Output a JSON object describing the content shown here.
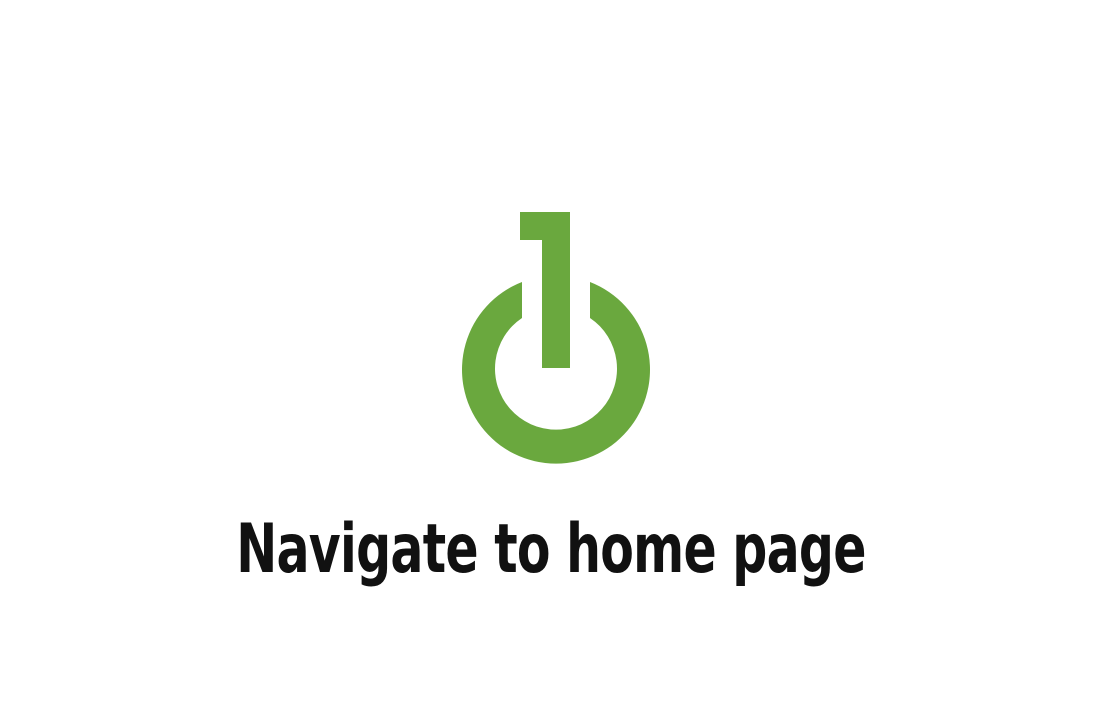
{
  "home_link": {
    "label": "Navigate to home page"
  },
  "logo": {
    "icon": "power-one-icon",
    "color": "#6aa83e"
  },
  "colors": {
    "background": "#ffffff",
    "text": "#111111",
    "brand": "#6aa83e"
  }
}
